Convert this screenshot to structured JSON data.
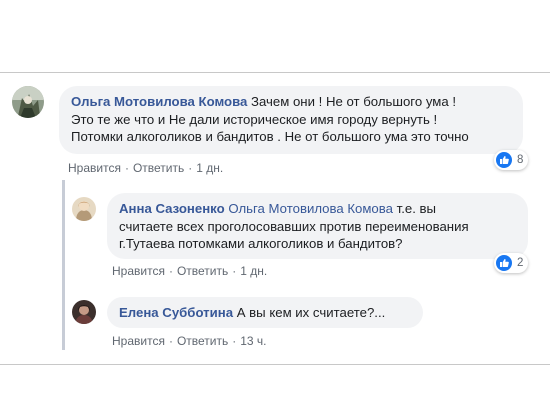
{
  "colors": {
    "author": "#385898",
    "bubble": "#f2f3f5",
    "like": "#1877f2",
    "thread_line": "#c7ccd6"
  },
  "comments": [
    {
      "author": "Ольга Мотовилова Комова",
      "lines": [
        "Зачем они ! Не от большого ума !",
        "Это те же что и Не дали историческое имя городу вернуть !",
        "Потомки алкоголиков и бандитов . Не от большого ума это точно"
      ],
      "reactions": {
        "icon": "like-icon",
        "count": "8"
      },
      "actions": {
        "like": "Нравится",
        "reply": "Ответить",
        "time": "1 дн."
      }
    },
    {
      "author": "Анна Сазоненко",
      "mention": "Ольга Мотовилова Комова",
      "lines": [
        "т.е. вы",
        "считаете всех проголосовавших против переименования",
        "г.Тутаева потомками алкоголиков и бандитов?"
      ],
      "reactions": {
        "icon": "like-icon",
        "count": "2"
      },
      "actions": {
        "like": "Нравится",
        "reply": "Ответить",
        "time": "1 дн."
      }
    },
    {
      "author": "Елена Субботина",
      "lines": [
        "А вы кем их считаете?..."
      ],
      "actions": {
        "like": "Нравится",
        "reply": "Ответить",
        "time": "13 ч."
      }
    }
  ]
}
